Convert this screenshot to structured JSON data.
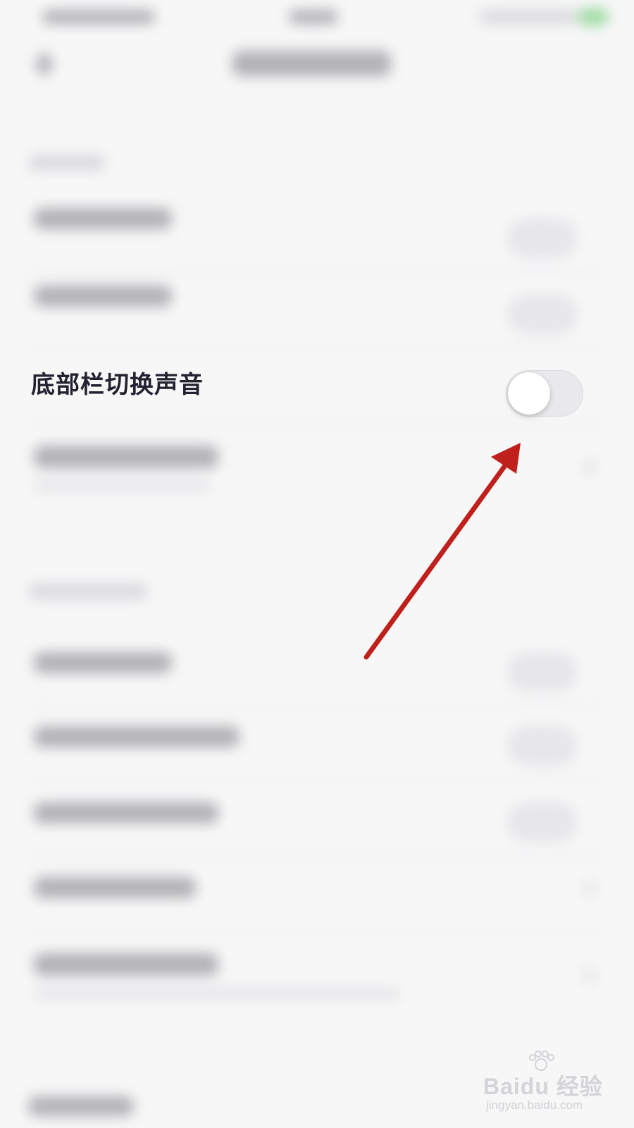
{
  "settings_row": {
    "label": "底部栏切换声音",
    "toggle_state": "off"
  },
  "watermark": {
    "brand": "Baidu 经验",
    "url": "jingyan.baidu.com"
  },
  "annotation": {
    "arrow_color": "#c0201b",
    "points_to": "toggle-switch"
  }
}
